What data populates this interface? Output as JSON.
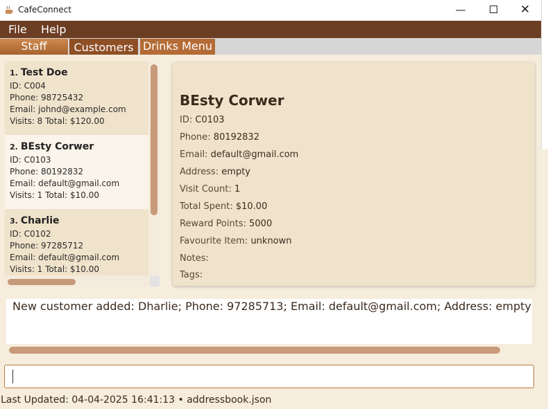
{
  "window": {
    "title": "CafeConnect",
    "icon": "coffee-cup-icon",
    "minimize_icon": "minimize-icon",
    "maximize_icon": "maximize-icon",
    "close_icon": "close-icon",
    "minimize_glyph": "—",
    "close_glyph": "✕"
  },
  "menu": {
    "items": [
      {
        "label": "File"
      },
      {
        "label": "Help"
      }
    ]
  },
  "tabs": {
    "items": [
      {
        "label": "Staff"
      },
      {
        "label": "Customers"
      },
      {
        "label": "Drinks Menu"
      }
    ],
    "selected": "Customers"
  },
  "customers": {
    "list": [
      {
        "index": "1.",
        "name": "Test Doe",
        "id": "ID: C004",
        "phone": "Phone: 98725432",
        "email": "Email: johnd@example.com",
        "visits": "Visits: 8   Total: $120.00"
      },
      {
        "index": "2.",
        "name": "BEsty Corwer",
        "id": "ID: C0103",
        "phone": "Phone: 80192832",
        "email": "Email: default@gmail.com",
        "visits": "Visits: 1   Total: $10.00"
      },
      {
        "index": "3.",
        "name": "Charlie",
        "id": "ID: C0102",
        "phone": "Phone: 97285712",
        "email": "Email: default@gmail.com",
        "visits": "Visits: 1   Total: $10.00"
      }
    ]
  },
  "detail": {
    "name": "BEsty Corwer",
    "rows": [
      {
        "label": "ID:",
        "value": "C0103"
      },
      {
        "label": "Phone:",
        "value": "80192832"
      },
      {
        "label": "Email:",
        "value": "default@gmail.com"
      },
      {
        "label": "Address:",
        "value": "empty"
      },
      {
        "label": "Visit Count:",
        "value": "1"
      },
      {
        "label": "Total Spent:",
        "value": "$10.00"
      },
      {
        "label": "Reward Points:",
        "value": "5000"
      },
      {
        "label": "Favourite Item:",
        "value": "unknown"
      },
      {
        "label": "Notes:",
        "value": ""
      },
      {
        "label": "Tags:",
        "value": ""
      }
    ]
  },
  "result": {
    "text": "New customer added: Dharlie; Phone: 97285713; Email: default@gmail.com; Address: empty; T"
  },
  "command": {
    "value": ""
  },
  "status": {
    "text": "Last Updated: 04-04-2025 16:41:13 • addressbook.json"
  },
  "colors": {
    "menu_bar": "#6b3d22",
    "tab_selected": "#8e4f25",
    "panel_bg": "#f6eddd",
    "card_alt": "#f0e3cb",
    "scroll_thumb": "#c79a7a"
  }
}
